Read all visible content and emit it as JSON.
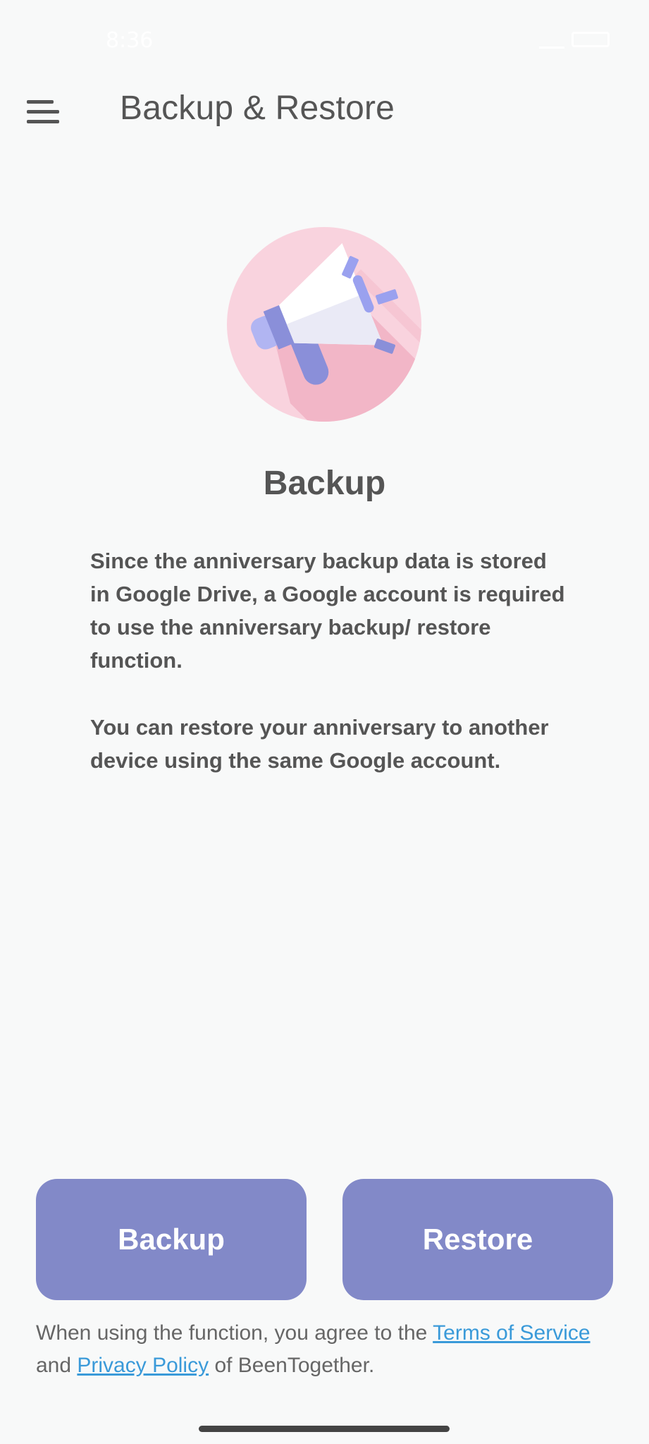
{
  "status_bar": {
    "time": "8:36"
  },
  "app_bar": {
    "title": "Backup & Restore",
    "menu_icon": "hamburger-menu-icon"
  },
  "illustration": {
    "icon": "megaphone-icon",
    "colors": {
      "circle": "#f9d3de",
      "megaphone_body": "#ffffff",
      "megaphone_handle": "#8a8fd9",
      "confetti": "#9aa1ef"
    }
  },
  "content": {
    "heading": "Backup",
    "paragraph_1": "Since the anniversary backup data is stored in Google Drive, a Google account is required to use the anniversary backup/ restore function.",
    "paragraph_2": "You can restore your anniversary to another device using the same Google account."
  },
  "actions": {
    "backup_label": "Backup",
    "restore_label": "Restore",
    "button_color": "#8289c8"
  },
  "legal": {
    "prefix": "When using the function, you agree to the ",
    "terms_link": "Terms of Service",
    "conjunction": " and ",
    "privacy_link": "Privacy Policy",
    "suffix": " of BeenTogether.",
    "link_color": "#3a9ad9"
  }
}
